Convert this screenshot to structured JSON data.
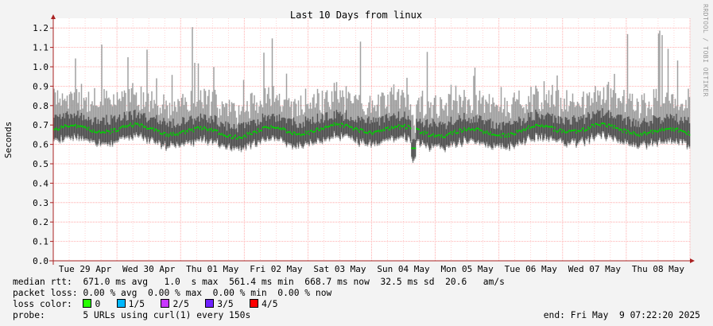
{
  "chart_data": {
    "type": "area",
    "title": "Last 10 Days from linux",
    "ylabel": "Seconds",
    "watermark": "RRDTOOL / TOBI OETIKER",
    "ylim": [
      0,
      1.25
    ],
    "yticks": [
      "0.0",
      "0.1",
      "0.2",
      "0.3",
      "0.4",
      "0.5",
      "0.6",
      "0.7",
      "0.8",
      "0.9",
      "1.0",
      "1.1",
      "1.2"
    ],
    "xticks": [
      "Tue 29 Apr",
      "Wed 30 Apr",
      "Thu 01 May",
      "Fri 02 May",
      "Sat 03 May",
      "Sun 04 May",
      "Mon 05 May",
      "Tue 06 May",
      "Wed 07 May",
      "Thu 08 May"
    ],
    "grid": true,
    "series": [
      {
        "name": "median rtt",
        "values": [
          0.671
        ]
      }
    ],
    "colors": {
      "median": "#00d000",
      "smoke_dark": "#505050",
      "smoke_light": "#a0a0a0",
      "axis": "#aa2222",
      "grid": "#ff9999",
      "background": "#ffffff"
    }
  },
  "stats": {
    "median_label": "median rtt:",
    "median_values": "671.0 ms avg   1.0  s max  561.4 ms min  668.7 ms now  32.5 ms sd  20.6   am/s",
    "loss_label": "packet loss:",
    "loss_values": "0.00 % avg  0.00 % max  0.00 % min  0.00 % now",
    "color_label": "loss color:",
    "loss_colors": [
      {
        "label": "0",
        "color": "#26ff00"
      },
      {
        "label": "1/5",
        "color": "#00b8ff"
      },
      {
        "label": "2/5",
        "color": "#c837ff"
      },
      {
        "label": "3/5",
        "color": "#6e21ff"
      },
      {
        "label": "4/5",
        "color": "#ff0000"
      }
    ],
    "probe_label": "probe:",
    "probe_value": "5 URLs using curl(1) every 150s",
    "end_text": "end: Fri May  9 07:22:20 2025"
  }
}
